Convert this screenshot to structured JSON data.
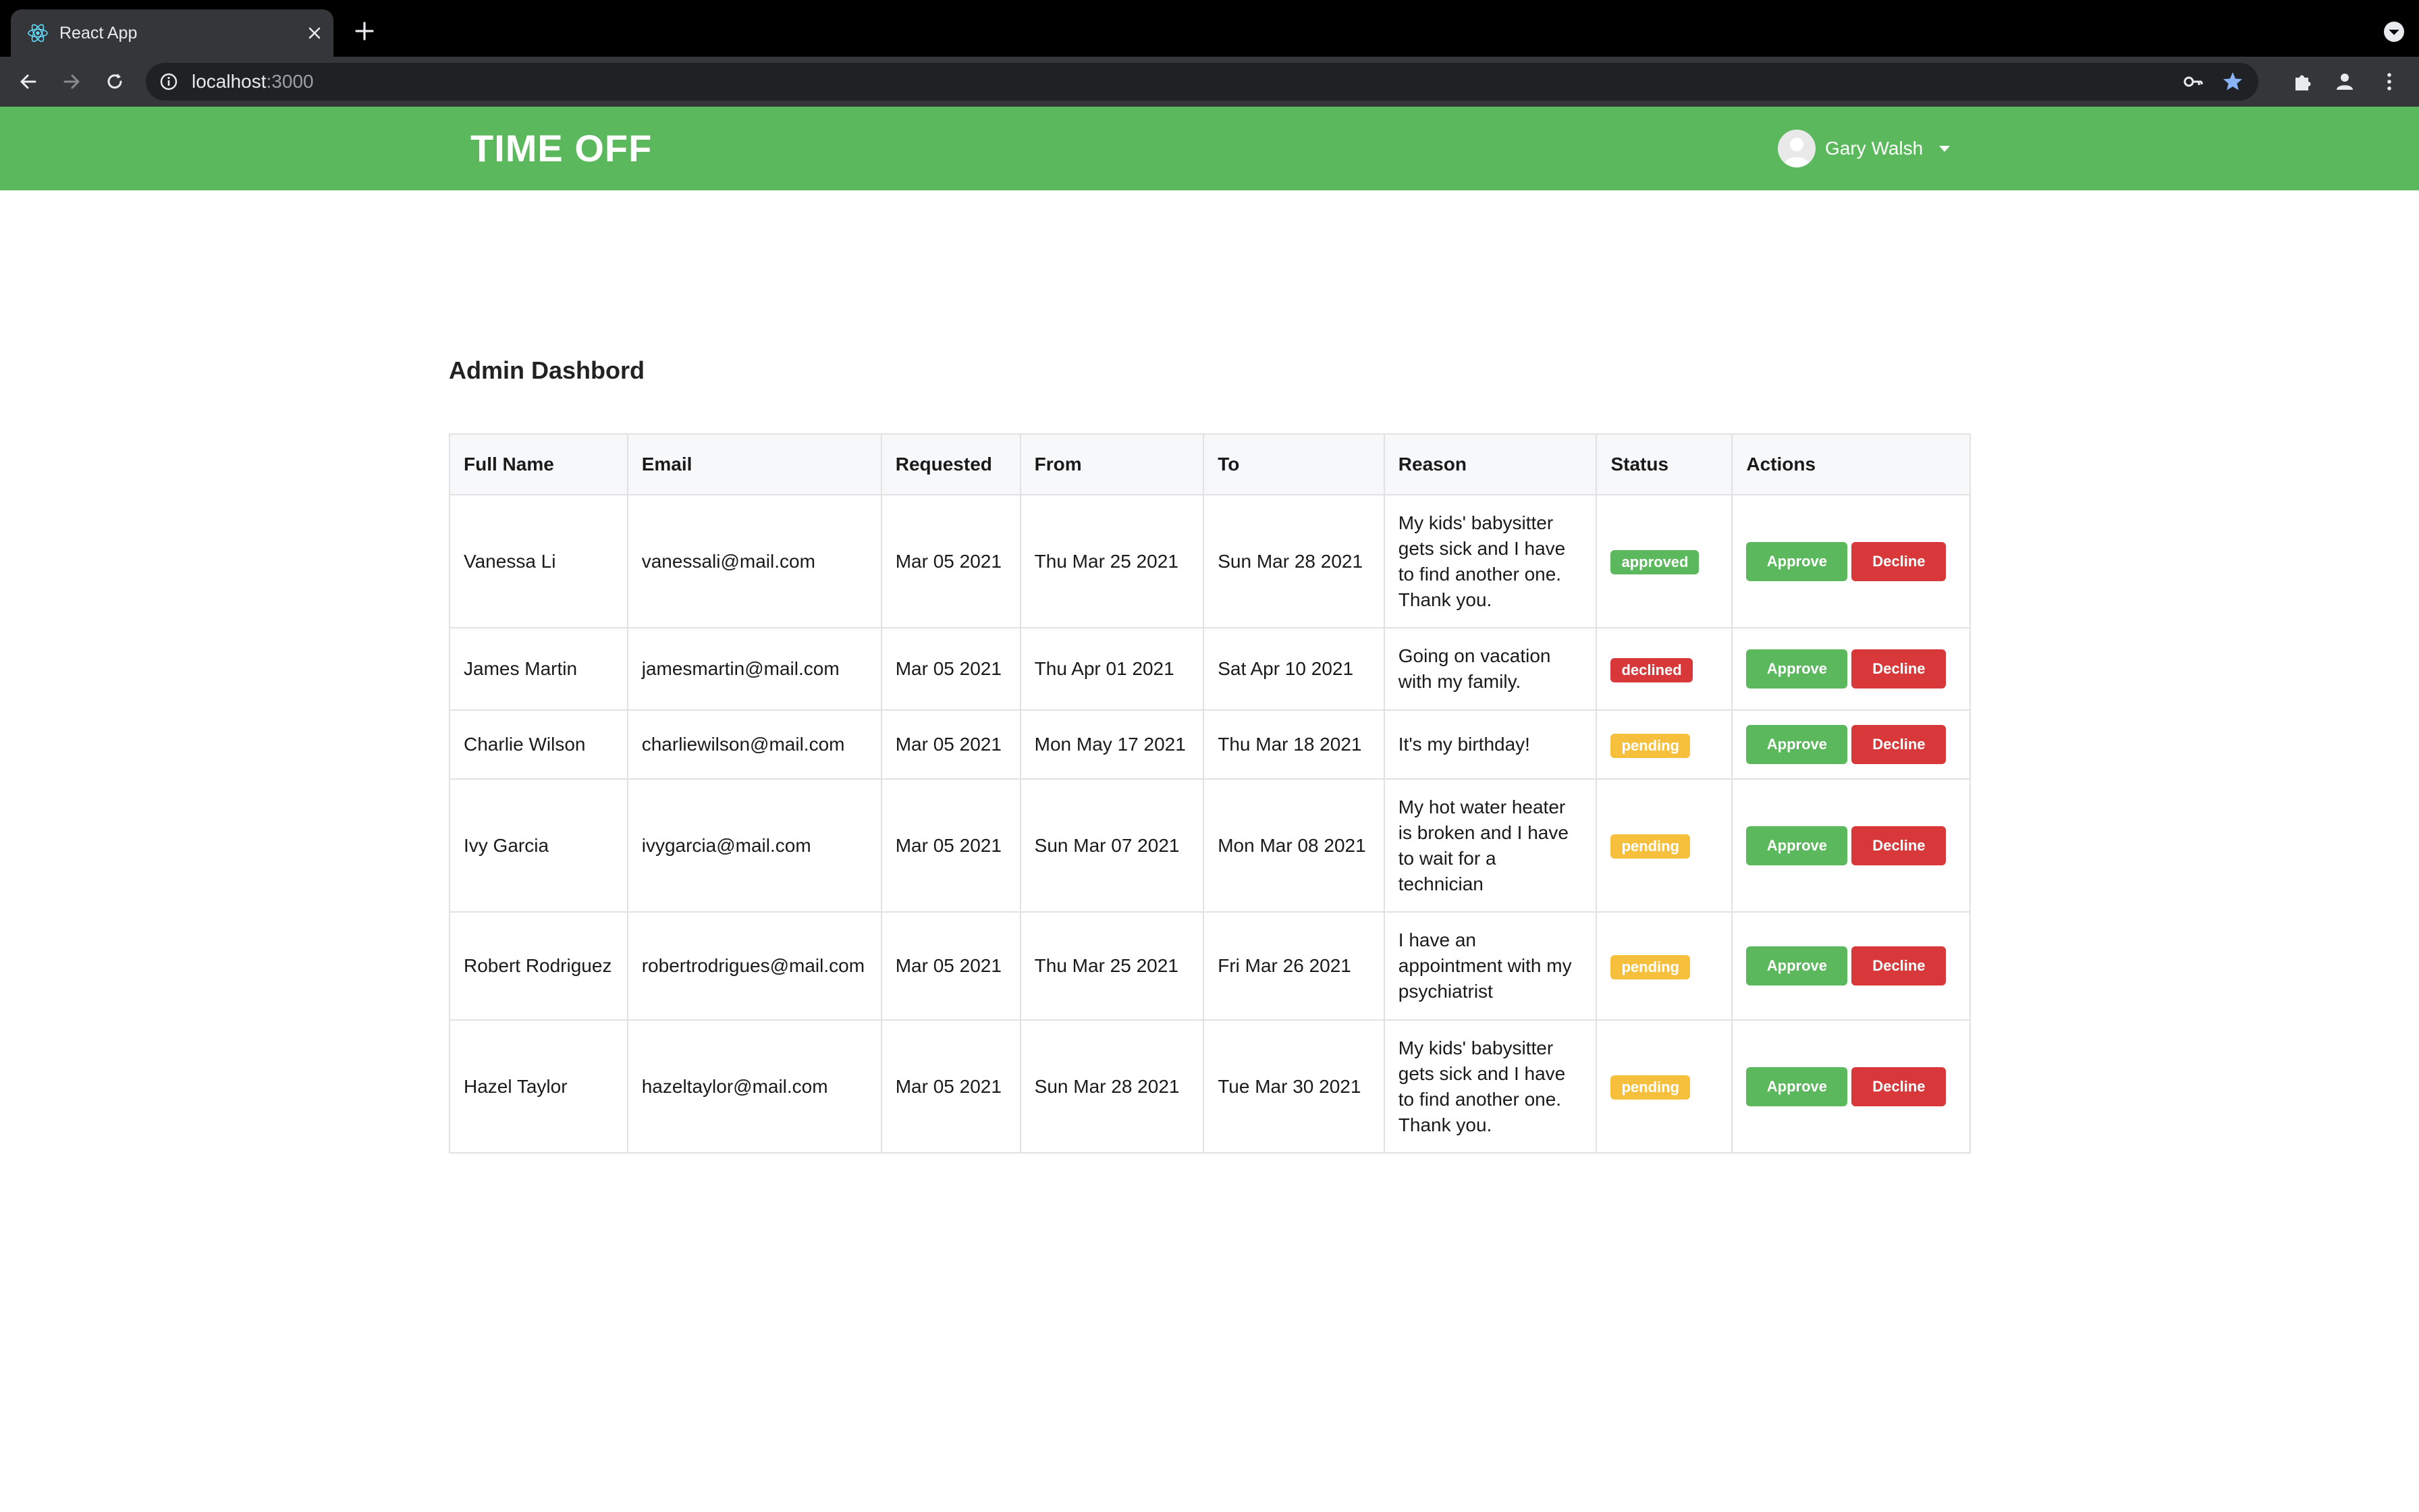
{
  "browser": {
    "tab_title": "React App",
    "url_host": "localhost",
    "url_port": ":3000"
  },
  "header": {
    "brand": "TIME OFF",
    "user_name": "Gary Walsh",
    "accent_color": "#5cb85c"
  },
  "main": {
    "page_title": "Admin Dashbord",
    "columns": [
      "Full Name",
      "Email",
      "Requested",
      "From",
      "To",
      "Reason",
      "Status",
      "Actions"
    ],
    "approve_label": "Approve",
    "decline_label": "Decline",
    "rows": [
      {
        "name": "Vanessa Li",
        "email": "vanessali@mail.com",
        "requested": "Mar 05 2021",
        "from": "Thu Mar 25 2021",
        "to": "Sun Mar 28 2021",
        "reason": "My kids' babysitter gets sick and I have to find another one. Thank you.",
        "status": "approved"
      },
      {
        "name": "James Martin",
        "email": "jamesmartin@mail.com",
        "requested": "Mar 05 2021",
        "from": "Thu Apr 01 2021",
        "to": "Sat Apr 10 2021",
        "reason": "Going on vacation with my family.",
        "status": "declined"
      },
      {
        "name": "Charlie Wilson",
        "email": "charliewilson@mail.com",
        "requested": "Mar 05 2021",
        "from": "Mon May 17 2021",
        "to": "Thu Mar 18 2021",
        "reason": "It's my birthday!",
        "status": "pending"
      },
      {
        "name": "Ivy Garcia",
        "email": "ivygarcia@mail.com",
        "requested": "Mar 05 2021",
        "from": "Sun Mar 07 2021",
        "to": "Mon Mar 08 2021",
        "reason": "My hot water heater is broken and I have to wait for a technician",
        "status": "pending"
      },
      {
        "name": "Robert Rodriguez",
        "email": "robertrodrigues@mail.com",
        "requested": "Mar 05 2021",
        "from": "Thu Mar 25 2021",
        "to": "Fri Mar 26 2021",
        "reason": "I have an appointment with my psychiatrist",
        "status": "pending"
      },
      {
        "name": "Hazel Taylor",
        "email": "hazeltaylor@mail.com",
        "requested": "Mar 05 2021",
        "from": "Sun Mar 28 2021",
        "to": "Tue Mar 30 2021",
        "reason": "My kids' babysitter gets sick and I have to find another one. Thank you.",
        "status": "pending"
      }
    ]
  },
  "status_colors": {
    "approved": "#5cb85c",
    "declined": "#d9383a",
    "pending": "#f6c03d"
  }
}
